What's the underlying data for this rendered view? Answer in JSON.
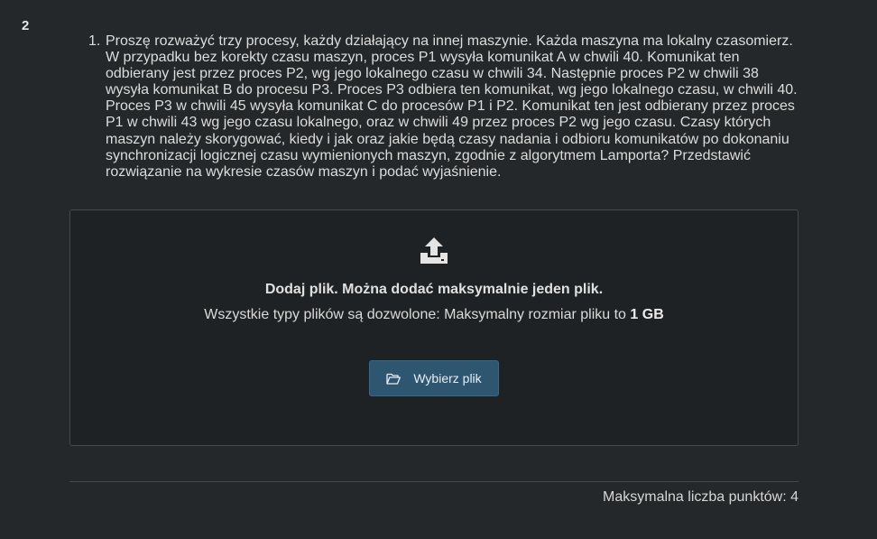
{
  "question": {
    "number": "2",
    "item_marker": "1.",
    "text": "Proszę rozważyć trzy procesy, każdy działający na innej maszynie. Każda maszyna ma lokalny czasomierz. W przypadku bez korekty czasu maszyn, proces P1 wysyła komunikat A w chwili 40. Komunikat ten odbierany jest przez proces P2, wg jego lokalnego czasu w chwili 34. Następnie proces P2 w chwili 38 wysyła komunikat B do procesu P3. Proces P3 odbiera ten komunikat, wg jego lokalnego czasu, w chwili 40. Proces P3 w chwili 45 wysyła komunikat C do procesów P1 i P2. Komunikat ten jest odbierany przez proces P1 w chwili 43 wg  jego czasu lokalnego, oraz w chwili 49 przez proces P2 wg jego czasu. Czasy których maszyn należy skorygować, kiedy i jak oraz jakie będą czasy nadania i odbioru komunikatów po dokonaniu synchronizacji logicznej czasu wymienionych maszyn, zgodnie z algorytmem Lamporta? Przedstawić rozwiązanie na wykresie czasów maszyn i podać wyjaśnienie."
  },
  "upload": {
    "icon": "upload-icon",
    "title": "Dodaj plik. Można dodać maksymalnie jeden plik.",
    "info_prefix": "Wszystkie typy plików są dozwolone: Maksymalny rozmiar pliku to",
    "max_size": "1 GB",
    "button_label": "Wybierz plik",
    "button_icon": "folder-open-icon"
  },
  "footer": {
    "max_points": "Maksymalna liczba punktów: 4"
  },
  "colors": {
    "background": "#25282a",
    "dropzone_background": "#1f2224",
    "button_background": "#2f5670"
  }
}
